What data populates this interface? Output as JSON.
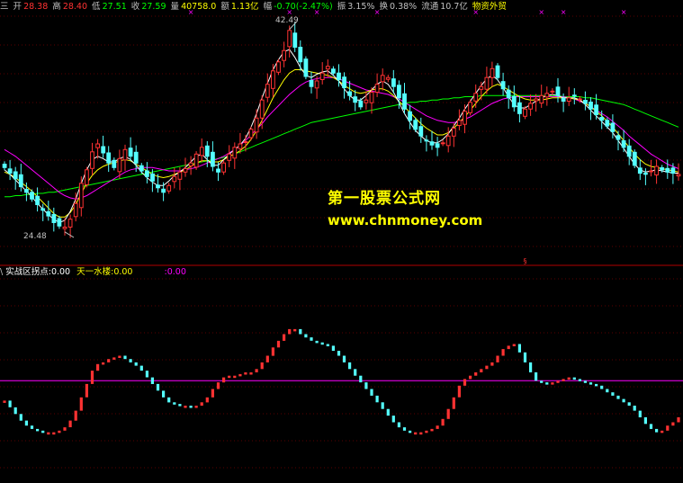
{
  "header": {
    "prefix": "三",
    "open_label": "开",
    "open": "28.38",
    "high_label": "高",
    "high": "28.40",
    "low_label": "低",
    "low": "27.51",
    "close_label": "收",
    "close": "27.59",
    "volume_label": "量",
    "volume": "40758.0",
    "amount_label": "额",
    "amount": "1.13亿",
    "change_label": "幅",
    "change": "-0.70(-2.47%)",
    "amplitude_label": "振",
    "amplitude": "3.15%",
    "turnover_label": "换",
    "turnover": "0.38%",
    "float_label": "流通",
    "float": "10.7亿",
    "sector": "物资外贸"
  },
  "watermark": {
    "title": "第一股票公式网",
    "url": "www.chnmoney.com"
  },
  "indicator": {
    "prefix": "\\",
    "name": "实战区拐点:",
    "value": "0.00",
    "sub_name": "天一水楼:",
    "sub_value": "0.00",
    "extra": ":0.00"
  },
  "colors": {
    "up": "#ff3232",
    "down": "#54ffff",
    "ma5": "#ffffff",
    "ma10": "#ffff00",
    "ma20": "#ff00ff",
    "ma60": "#00ff00",
    "horizontal_line": "#ff00ff",
    "marker": "#ff00ff",
    "label_yellow": "#ffff00",
    "label_green": "#00ff00"
  },
  "chart_data": [
    {
      "type": "candlestick",
      "title": "",
      "annotations": [
        {
          "label": "42.49",
          "type": "max"
        },
        {
          "label": "24.48",
          "type": "min"
        }
      ],
      "ylim": [
        23.5,
        43.5
      ],
      "n_bars": 124,
      "close": [
        30.2,
        29.7,
        29.2,
        28.5,
        28.0,
        27.4,
        26.9,
        26.4,
        25.9,
        25.3,
        25.0,
        24.9,
        25.6,
        27.0,
        28.8,
        30.0,
        31.6,
        32.3,
        31.5,
        30.6,
        30.2,
        31.0,
        31.8,
        31.2,
        30.6,
        29.9,
        29.4,
        29.0,
        28.4,
        28.0,
        28.6,
        29.4,
        29.8,
        30.1,
        30.6,
        31.4,
        32.0,
        31.2,
        30.3,
        29.8,
        30.6,
        31.4,
        32.0,
        32.3,
        32.5,
        33.6,
        34.6,
        36.2,
        37.6,
        38.8,
        39.6,
        40.6,
        42.4,
        40.9,
        39.6,
        38.3,
        37.4,
        37.9,
        38.6,
        39.2,
        38.6,
        38.0,
        37.3,
        36.6,
        36.0,
        35.6,
        36.2,
        36.9,
        37.6,
        38.4,
        38.2,
        37.4,
        36.4,
        35.4,
        34.4,
        33.6,
        33.0,
        32.6,
        32.2,
        32.0,
        32.4,
        33.0,
        33.7,
        34.4,
        35.2,
        36.0,
        36.8,
        37.4,
        38.2,
        39.0,
        38.2,
        37.2,
        36.4,
        35.6,
        35.0,
        35.4,
        35.9,
        36.3,
        36.6,
        36.8,
        37.0,
        36.6,
        36.1,
        36.4,
        36.6,
        36.3,
        35.9,
        35.4,
        34.9,
        34.4,
        33.9,
        33.4,
        32.7,
        32.0,
        31.2,
        30.4,
        29.7,
        29.6,
        29.9,
        30.3,
        30.0,
        29.8,
        29.7,
        29.6
      ],
      "ma5": [
        30.0,
        29.6,
        29.1,
        28.6,
        28.1,
        27.6,
        27.0,
        26.5,
        26.0,
        25.6,
        25.3,
        25.5,
        26.3,
        27.4,
        28.8,
        30.0,
        30.9,
        31.2,
        31.0,
        30.7,
        30.7,
        31.0,
        31.2,
        30.9,
        30.4,
        29.8,
        29.3,
        28.9,
        28.6,
        28.6,
        29.0,
        29.5,
        29.8,
        30.2,
        30.7,
        31.2,
        31.4,
        30.9,
        30.4,
        30.4,
        30.9,
        31.4,
        31.8,
        32.2,
        32.8,
        33.8,
        35.0,
        36.4,
        37.7,
        38.9,
        39.8,
        40.5,
        40.7,
        40.0,
        39.1,
        38.4,
        38.2,
        38.5,
        38.7,
        38.8,
        38.4,
        37.9,
        37.2,
        36.6,
        36.2,
        36.2,
        36.6,
        37.1,
        37.6,
        37.9,
        37.6,
        36.9,
        36.0,
        35.0,
        34.2,
        33.5,
        33.0,
        32.6,
        32.4,
        32.4,
        32.7,
        33.2,
        33.9,
        34.6,
        35.4,
        36.1,
        36.8,
        37.5,
        38.1,
        38.4,
        38.0,
        37.3,
        36.5,
        35.8,
        35.5,
        35.5,
        35.8,
        36.1,
        36.4,
        36.6,
        36.7,
        36.6,
        36.4,
        36.4,
        36.4,
        36.2,
        35.8,
        35.3,
        34.8,
        34.3,
        33.8,
        33.3,
        32.6,
        31.9,
        31.2,
        30.5,
        30.0,
        29.8,
        29.9,
        30.0,
        29.9,
        29.8,
        29.7,
        29.7
      ],
      "ma10": [
        29.8,
        29.6,
        29.3,
        28.9,
        28.5,
        28.1,
        27.6,
        27.1,
        26.6,
        26.1,
        25.8,
        25.8,
        26.2,
        26.9,
        27.9,
        28.8,
        29.5,
        30.0,
        30.3,
        30.5,
        30.6,
        30.8,
        30.9,
        30.8,
        30.5,
        30.2,
        29.9,
        29.6,
        29.4,
        29.3,
        29.4,
        29.6,
        29.8,
        30.0,
        30.3,
        30.6,
        30.8,
        30.8,
        30.7,
        30.7,
        30.9,
        31.2,
        31.4,
        31.7,
        32.1,
        32.7,
        33.5,
        34.4,
        35.4,
        36.4,
        37.2,
        38.0,
        38.6,
        38.9,
        38.9,
        38.8,
        38.7,
        38.6,
        38.5,
        38.4,
        38.2,
        37.9,
        37.5,
        37.2,
        36.9,
        36.8,
        36.9,
        37.1,
        37.2,
        37.2,
        37.0,
        36.6,
        36.1,
        35.6,
        35.1,
        34.6,
        34.1,
        33.7,
        33.4,
        33.1,
        33.1,
        33.3,
        33.7,
        34.2,
        34.7,
        35.3,
        35.9,
        36.5,
        37.0,
        37.4,
        37.6,
        37.4,
        37.1,
        36.8,
        36.5,
        36.3,
        36.2,
        36.2,
        36.2,
        36.3,
        36.4,
        36.4,
        36.4,
        36.4,
        36.3,
        36.2,
        35.9,
        35.6,
        35.2,
        34.8,
        34.3,
        33.8,
        33.2,
        32.6,
        32.0,
        31.4,
        30.9,
        30.5,
        30.3,
        30.2,
        30.1,
        30.0,
        29.9,
        29.8
      ],
      "ma20": [
        31.8,
        31.5,
        31.2,
        30.8,
        30.4,
        30.0,
        29.6,
        29.2,
        28.8,
        28.4,
        28.0,
        27.7,
        27.5,
        27.4,
        27.5,
        27.7,
        28.0,
        28.3,
        28.6,
        28.9,
        29.2,
        29.5,
        29.8,
        30.0,
        30.1,
        30.2,
        30.2,
        30.2,
        30.1,
        30.0,
        29.9,
        29.9,
        29.9,
        30.0,
        30.1,
        30.2,
        30.4,
        30.6,
        30.8,
        31.0,
        31.2,
        31.5,
        31.8,
        32.2,
        32.6,
        33.1,
        33.6,
        34.1,
        34.7,
        35.2,
        35.7,
        36.2,
        36.7,
        37.1,
        37.5,
        37.8,
        38.0,
        38.1,
        38.2,
        38.2,
        38.2,
        38.1,
        37.9,
        37.7,
        37.5,
        37.3,
        37.1,
        37.0,
        36.9,
        36.8,
        36.7,
        36.5,
        36.3,
        36.0,
        35.7,
        35.4,
        35.1,
        34.8,
        34.6,
        34.4,
        34.3,
        34.2,
        34.2,
        34.3,
        34.5,
        34.7,
        35.0,
        35.3,
        35.6,
        35.9,
        36.1,
        36.3,
        36.4,
        36.5,
        36.5,
        36.5,
        36.5,
        36.5,
        36.5,
        36.5,
        36.5,
        36.5,
        36.5,
        36.4,
        36.3,
        36.1,
        35.9,
        35.6,
        35.3,
        35.0,
        34.7,
        34.3,
        33.9,
        33.5,
        33.0,
        32.6,
        32.2,
        31.8,
        31.4,
        31.1,
        30.8,
        30.5,
        30.3,
        30.1
      ],
      "ma60": [
        27.6,
        27.6,
        27.7,
        27.7,
        27.8,
        27.8,
        27.9,
        27.9,
        28.0,
        28.0,
        28.1,
        28.2,
        28.3,
        28.4,
        28.5,
        28.6,
        28.7,
        28.8,
        28.9,
        29.0,
        29.1,
        29.2,
        29.3,
        29.4,
        29.5,
        29.6,
        29.7,
        29.8,
        29.9,
        30.0,
        30.1,
        30.2,
        30.3,
        30.4,
        30.5,
        30.6,
        30.7,
        30.8,
        30.9,
        31.0,
        31.1,
        31.2,
        31.4,
        31.6,
        31.8,
        32.0,
        32.2,
        32.4,
        32.6,
        32.8,
        33.0,
        33.2,
        33.4,
        33.6,
        33.8,
        34.0,
        34.2,
        34.3,
        34.4,
        34.5,
        34.6,
        34.7,
        34.8,
        34.9,
        35.0,
        35.1,
        35.2,
        35.3,
        35.4,
        35.5,
        35.6,
        35.7,
        35.8,
        35.9,
        36.0,
        36.0,
        36.1,
        36.1,
        36.2,
        36.2,
        36.3,
        36.3,
        36.4,
        36.4,
        36.5,
        36.5,
        36.5,
        36.6,
        36.6,
        36.6,
        36.6,
        36.6,
        36.6,
        36.6,
        36.6,
        36.6,
        36.6,
        36.6,
        36.6,
        36.6,
        36.6,
        36.6,
        36.5,
        36.5,
        36.5,
        36.5,
        36.4,
        36.4,
        36.3,
        36.2,
        36.1,
        36.0,
        35.9,
        35.8,
        35.6,
        35.4,
        35.2,
        35.0,
        34.8,
        34.6,
        34.4,
        34.2,
        34.0,
        33.8
      ]
    },
    {
      "type": "dot_line",
      "title": "实战区拐点",
      "ylim": [
        0,
        100
      ],
      "level": 55,
      "values": [
        43,
        39,
        35,
        31,
        28,
        26,
        25,
        24,
        24,
        24,
        25,
        27,
        31,
        37,
        45,
        53,
        61,
        65,
        66,
        68,
        69,
        70,
        68,
        66,
        64,
        61,
        57,
        53,
        49,
        45,
        42,
        41,
        40,
        40,
        39,
        40,
        42,
        45,
        50,
        54,
        57,
        58,
        58,
        59,
        60,
        60,
        62,
        66,
        70,
        75,
        79,
        83,
        86,
        86,
        83,
        81,
        79,
        78,
        77,
        76,
        73,
        70,
        66,
        62,
        58,
        54,
        50,
        46,
        42,
        38,
        34,
        30,
        27,
        25,
        24,
        24,
        24,
        25,
        26,
        28,
        32,
        38,
        45,
        52,
        56,
        58,
        60,
        62,
        64,
        66,
        70,
        74,
        76,
        77,
        72,
        66,
        60,
        55,
        54,
        53,
        54,
        55,
        56,
        57,
        56,
        55,
        54,
        53,
        52,
        50,
        48,
        46,
        44,
        42,
        40,
        37,
        33,
        29,
        26,
        24,
        25,
        28,
        30,
        33
      ]
    }
  ]
}
